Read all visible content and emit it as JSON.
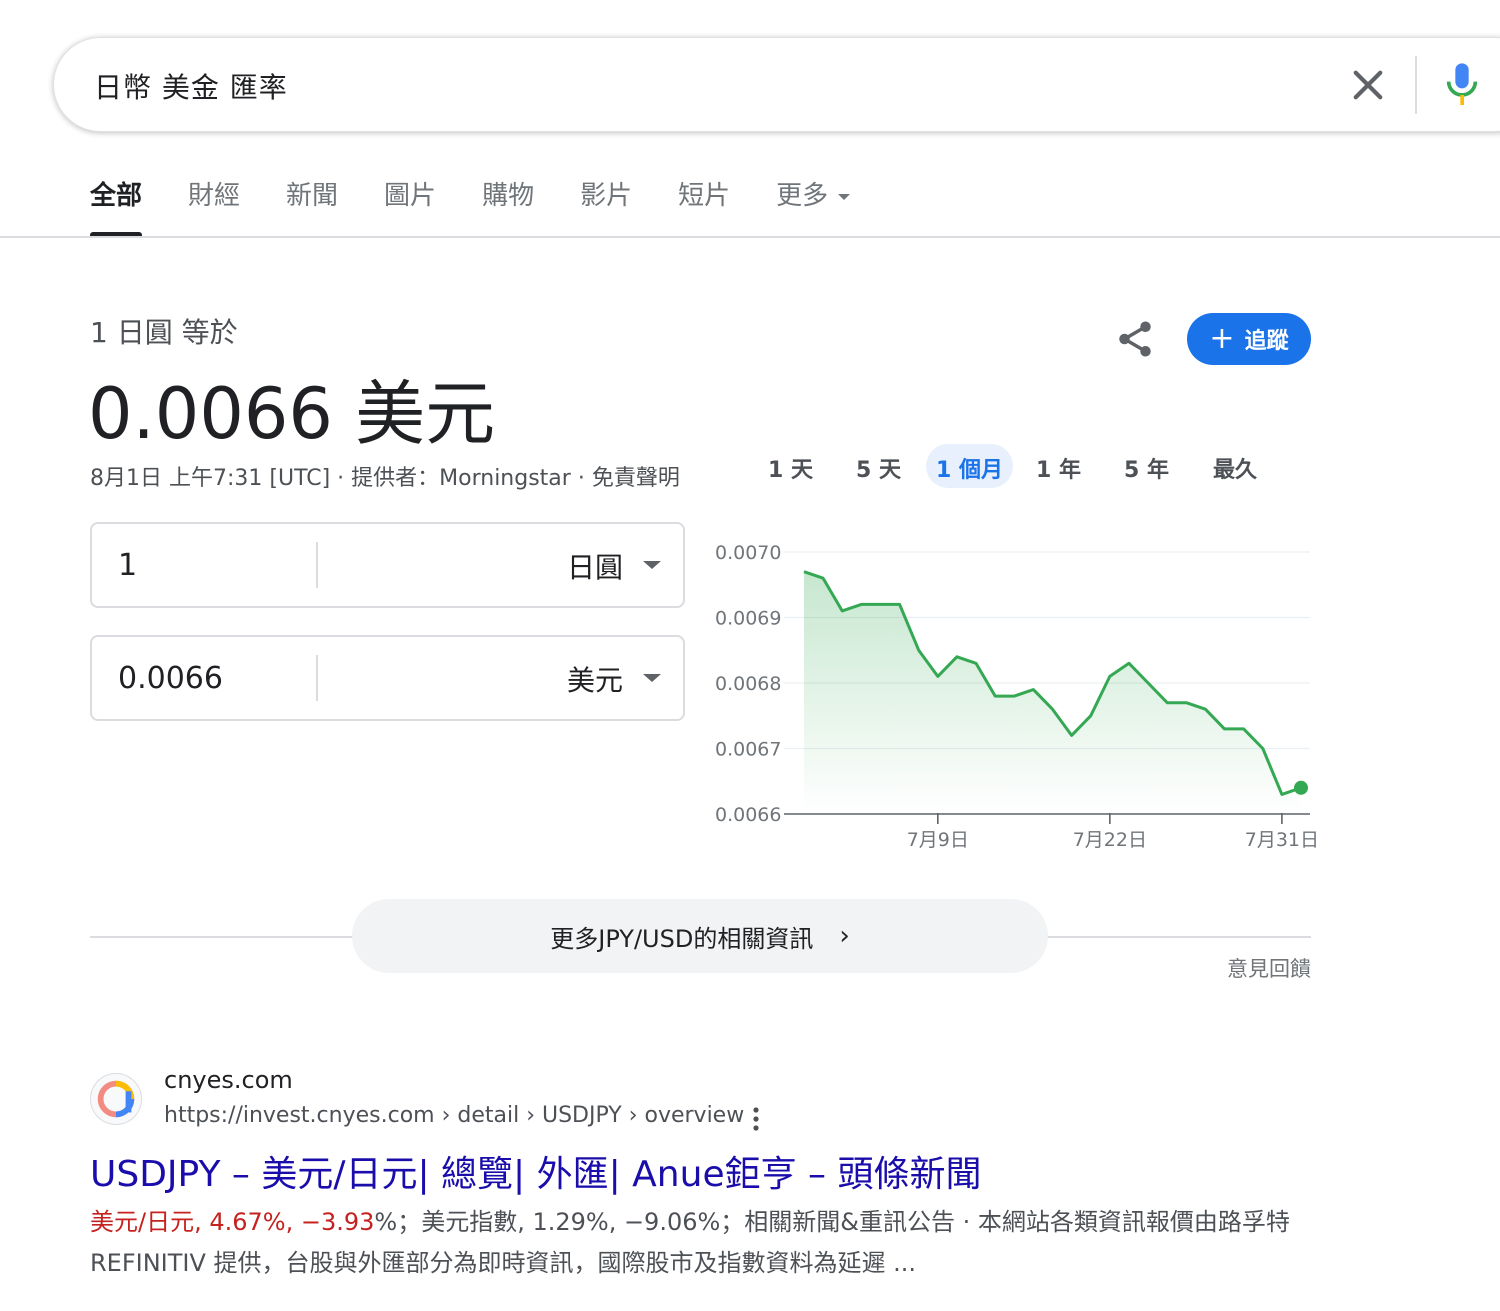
{
  "search": {
    "query": "日幣 美金 匯率"
  },
  "tabs": [
    {
      "label": "全部",
      "active": true
    },
    {
      "label": "財經"
    },
    {
      "label": "新聞"
    },
    {
      "label": "圖片"
    },
    {
      "label": "購物"
    },
    {
      "label": "影片"
    },
    {
      "label": "短片"
    },
    {
      "label": "更多"
    }
  ],
  "converter": {
    "equals_label": "1 日圓 等於",
    "rate": "0.0066 美元",
    "timestamp": "8月1日 上午7:31 [UTC]",
    "provider": "提供者：Morningstar",
    "disclaimer": "免責聲明",
    "follow_label": "追蹤",
    "from_amount": "1",
    "from_currency": "日圓",
    "to_amount": "0.0066",
    "to_currency": "美元"
  },
  "ranges": [
    "1 天",
    "5 天",
    "1 個月",
    "1 年",
    "5 年",
    "最久"
  ],
  "active_range": "1 個月",
  "chart_data": {
    "type": "area",
    "series": [
      {
        "values": [
          0.00697,
          0.00696,
          0.00691,
          0.00692,
          0.00692,
          0.00692,
          0.00685,
          0.00681,
          0.00684,
          0.00683,
          0.00678,
          0.00678,
          0.00679,
          0.00676,
          0.00672,
          0.00675,
          0.00681,
          0.00683,
          0.0068,
          0.00677,
          0.00677,
          0.00676,
          0.00673,
          0.00673,
          0.0067,
          0.00663,
          0.00664
        ]
      }
    ],
    "yticks": [
      "0.0070",
      "0.0069",
      "0.0068",
      "0.0067",
      "0.0066"
    ],
    "xticks": [
      "7月9日",
      "7月22日",
      "7月31日"
    ],
    "ylim": [
      0.0066,
      0.007
    ],
    "color": "#34a853",
    "grid": true
  },
  "more_info": {
    "label": "更多JPY/USD的相關資訊",
    "feedback": "意見回饋"
  },
  "result": {
    "site_name": "cnyes.com",
    "url": "https://invest.cnyes.com › detail › USDJPY › overview",
    "title": "USDJPY – 美元/日元| 總覽| 外匯| Anue鉅亨 – 頭條新聞",
    "snippet_highlight": "美元/日元, 4.67%, −3.93",
    "snippet_rest": "%；美元指數, 1.29%, −9.06%；相關新聞&重訊公告 · 本網站各類資訊報價由路孚特REFINITIV 提供，台股與外匯部分為即時資訊，國際股市及指數資料為延遲 ..."
  }
}
